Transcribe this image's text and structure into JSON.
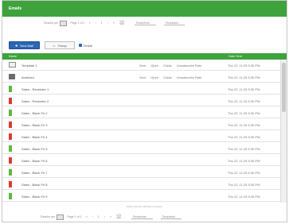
{
  "app": {
    "title": "Emails"
  },
  "pager_top": {
    "label_left": "Results per",
    "label_mid": "Page 1 of 1",
    "nav": [
      "«",
      "‹",
      "1",
      "›",
      "»"
    ],
    "stack": [
      "123",
      "456"
    ],
    "filter_a": "Recipients",
    "filter_b": "Templates"
  },
  "toolbar": {
    "new_label": "New Mail",
    "group_label": "Group",
    "delete_label": "Delete"
  },
  "grid": {
    "col_name": "Name",
    "col_sent": "Date Sent",
    "rows": [
      {
        "icon": "doc",
        "name": "Template 1",
        "meta": [
          "Sent",
          "Open",
          "Clicks",
          "Unsubscribe Rate"
        ],
        "sent": "Thu 22, 11:25 5:30 PM"
      },
      {
        "icon": "folder",
        "name": "Archived",
        "meta": [
          "Sent",
          "Open",
          "Clicks",
          "Unsubscribe Rate"
        ],
        "sent": "Thu 22, 11:25 5:30 PM"
      },
      {
        "icon": "greenbar",
        "name": "Sales - Reminder 1",
        "meta": [],
        "sent": "Thu 22, 11:25 5:30 PM"
      },
      {
        "icon": "redbar",
        "name": "Sales - Reminder 2",
        "meta": [],
        "sent": "Thu 22, 11:25 5:30 PM"
      },
      {
        "icon": "greenbar",
        "name": "Sales - Black Fri 2",
        "meta": [],
        "sent": "Thu 22, 11:25 5:30 PM"
      },
      {
        "icon": "redbar",
        "name": "Sales - Black Fri 3",
        "meta": [],
        "sent": "Thu 22, 11:25 5:30 PM"
      },
      {
        "icon": "redbar",
        "name": "Sales - Black Fri 4",
        "meta": [],
        "sent": "Thu 22, 11:25 5:30 PM"
      },
      {
        "icon": "greenbar",
        "name": "Sales - Black Fri 5",
        "meta": [],
        "sent": "Thu 22, 11:25 5:30 PM"
      },
      {
        "icon": "redbar",
        "name": "Sales - Black Fri 6",
        "meta": [],
        "sent": "Thu 22, 11:25 5:30 PM"
      },
      {
        "icon": "greenbar",
        "name": "Sales - Black Fri 7",
        "meta": [],
        "sent": "Thu 22, 11:25 5:30 PM"
      },
      {
        "icon": "redbar",
        "name": "Sales - Black Fri 8",
        "meta": [],
        "sent": "Thu 22, 11:25 5:30 PM"
      },
      {
        "icon": "greenbar",
        "name": "Sales - Black Fri 9",
        "meta": [],
        "sent": "Thu 22, 11:25 5:30 PM"
      }
    ]
  },
  "footer": {
    "note": "Show only first 100 items of query"
  },
  "pager_bottom": {
    "label_left": "Results per",
    "label_mid": "Page 1 of 1",
    "nav": [
      "«",
      "‹",
      "1",
      "›",
      "»"
    ],
    "stack": [
      "123",
      "456"
    ],
    "filter_a": "Recipients",
    "filter_b": "Templates"
  },
  "colors": {
    "accent_green": "#3ea23d",
    "primary_blue": "#2c67b1",
    "status_red": "#d93b30",
    "status_green": "#5fb83a"
  }
}
